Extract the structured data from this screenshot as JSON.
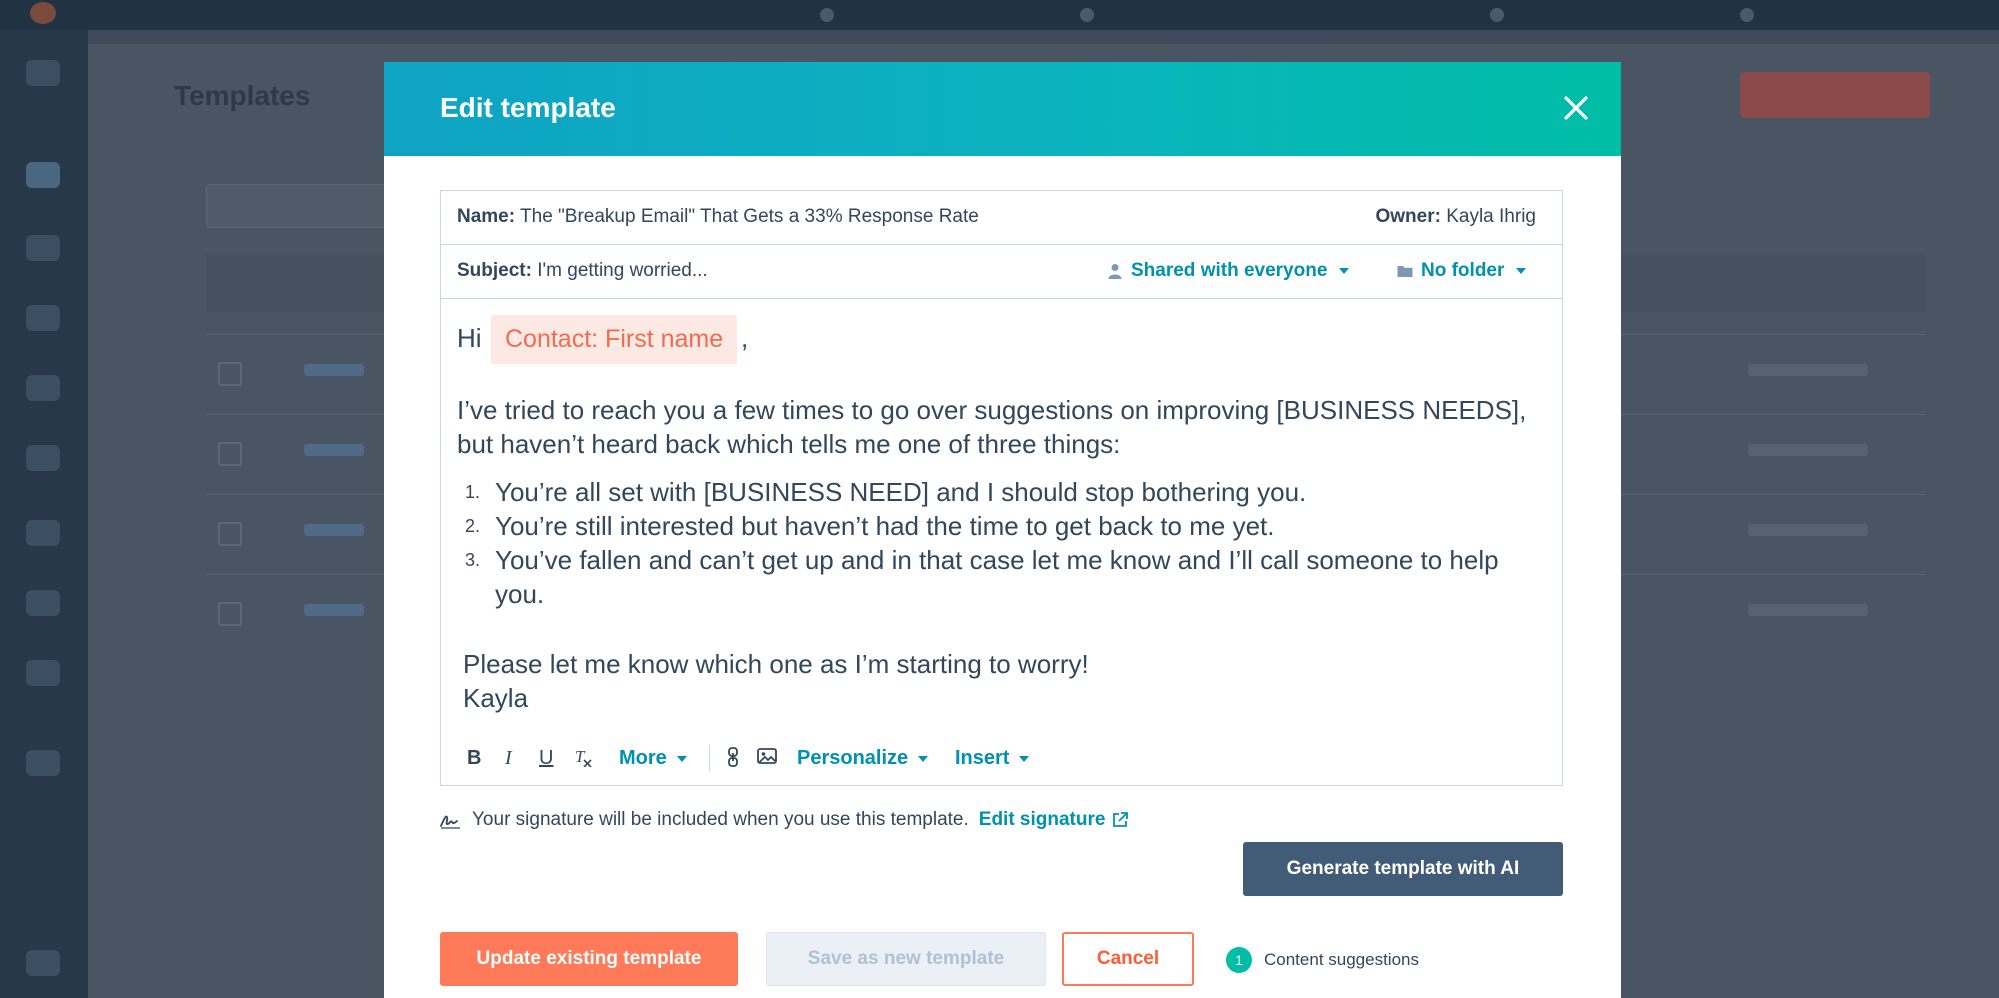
{
  "colors": {
    "header_start": "#0fa3c4",
    "header_end": "#00bda5",
    "link": "#0091ae",
    "primary_orange": "#ff7a59",
    "dark_button": "#425b76",
    "token_bg": "#fde9e3",
    "token_text": "#ef6c50"
  },
  "modal": {
    "title": "Edit template",
    "close_icon": "close-icon"
  },
  "template": {
    "name_label": "Name:",
    "name_value": "The \"Breakup Email\" That Gets a 33% Response Rate",
    "owner_label": "Owner:",
    "owner_value": "Kayla Ihrig",
    "subject_label": "Subject:",
    "subject_value": "I'm getting worried...",
    "sharing": "Shared with everyone",
    "folder": "No folder"
  },
  "body": {
    "greeting": "Hi",
    "token": "Contact: First name",
    "comma": ",",
    "paragraph": "I’ve tried to reach you a few times to go over suggestions on improving [BUSINESS NEEDS], but haven’t heard back which tells me one of three things:",
    "list": [
      {
        "num": "1.",
        "text": "You’re all set with [BUSINESS NEED] and I should stop bothering you."
      },
      {
        "num": "2.",
        "text": "You’re still interested but haven’t had the time to get back to me yet."
      },
      {
        "num": "3.",
        "text": "You’ve fallen and can’t get up and in that case let me know and I’ll call someone to help you."
      }
    ],
    "closing_line": "Please let me know which one as I’m starting to worry!",
    "sign_off": "Kayla"
  },
  "toolbar": {
    "bold": "B",
    "italic": "I",
    "underline": "U",
    "clear": "Tx",
    "more": "More",
    "personalize": "Personalize",
    "insert": "Insert"
  },
  "signature": {
    "text": "Your signature will be included when you use this template.",
    "edit_link": "Edit signature"
  },
  "actions": {
    "ai_button": "Generate template with AI",
    "update": "Update existing template",
    "save_new": "Save as new template",
    "cancel": "Cancel",
    "suggestion_count": "1",
    "suggestion_label": "Content suggestions"
  },
  "background": {
    "page_title": "Templates"
  }
}
